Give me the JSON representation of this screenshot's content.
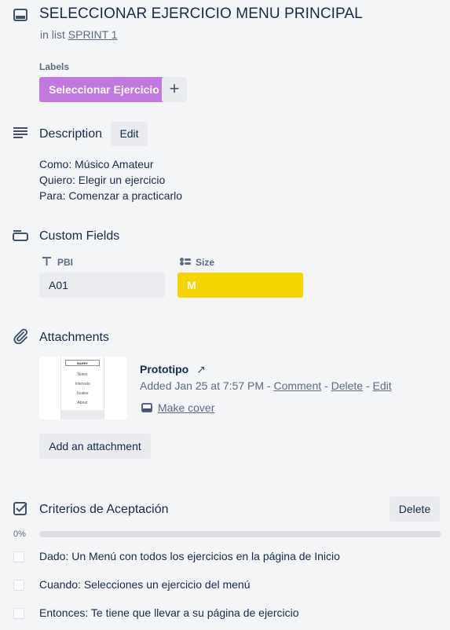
{
  "card": {
    "title": "SELECCIONAR EJERCICIO MENU PRINCIPAL",
    "in_list_prefix": "in list",
    "list_name": "SPRINT 1"
  },
  "labels": {
    "heading": "Labels",
    "items": [
      {
        "name": "Seleccionar Ejercicio",
        "color": "#c377e0"
      }
    ],
    "add_symbol": "+"
  },
  "description": {
    "title": "Description",
    "edit_label": "Edit",
    "lines": [
      "Como: Músico Amateur",
      "Quiero: Elegir un ejercicio",
      "Para: Comenzar a practicarlo"
    ]
  },
  "custom_fields": {
    "title": "Custom Fields",
    "fields": [
      {
        "name": "PBI",
        "value": "A01",
        "color": "#ebecf0"
      },
      {
        "name": "Size",
        "value": "M",
        "color": "#f5d400"
      }
    ]
  },
  "attachments": {
    "title": "Attachments",
    "items": [
      {
        "name": "Prototipo",
        "external_symbol": "↗",
        "added": "Added Jan 25 at 7:57 PM",
        "actions": [
          "Comment",
          "Delete",
          "Edit"
        ],
        "make_cover": "Make cover",
        "thumbnail": {
          "header": "BARRY",
          "menu": [
            "Notes",
            "Intervals",
            "Scales",
            "About"
          ]
        }
      }
    ],
    "add_label": "Add an attachment"
  },
  "checklist": {
    "title": "Criterios de Aceptación",
    "delete_label": "Delete",
    "progress_text": "0%",
    "progress": 0,
    "items": [
      {
        "text": "Dado: Un Menú con todos los ejercicios en la página de Inicio",
        "checked": false
      },
      {
        "text": "Cuando: Selecciones un ejercicio del menú",
        "checked": false
      },
      {
        "text": "Entonces: Te tiene que llevar a su página de ejercicio",
        "checked": false
      }
    ]
  },
  "icons": {
    "card": "card-icon",
    "description": "description-icon",
    "custom_fields": "custom-fields-icon",
    "text_field": "text-field-icon",
    "dropdown_field": "dropdown-field-icon",
    "attachment": "paperclip-icon",
    "cover": "cover-icon",
    "checklist": "checklist-icon"
  }
}
